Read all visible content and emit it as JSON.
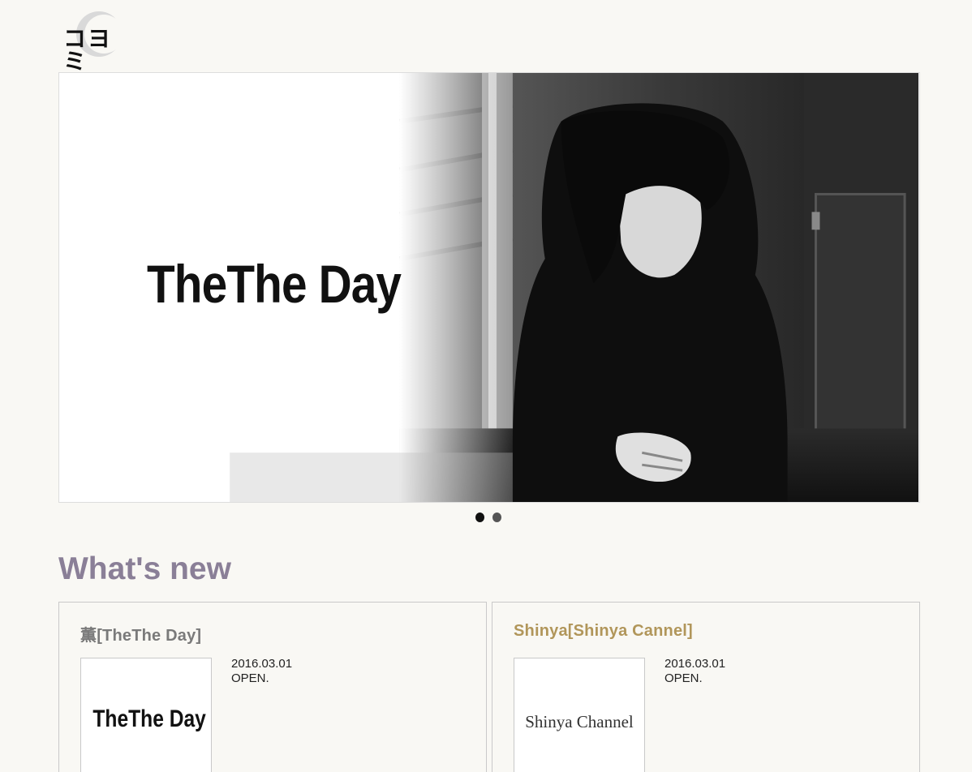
{
  "logo": {
    "text": "コヨミ"
  },
  "hero": {
    "title": "TheThe Day"
  },
  "slider": {
    "dots": 2,
    "active": 0
  },
  "section": {
    "title": "What's new"
  },
  "cards": [
    {
      "title": "薫[TheThe Day]",
      "thumb_text": "TheThe Day",
      "date": "2016.03.01",
      "status": "OPEN."
    },
    {
      "title": "Shinya[Shinya Cannel]",
      "thumb_text": "Shinya Channel",
      "date": "2016.03.01",
      "status": "OPEN."
    }
  ],
  "colors": {
    "background": "#f9f8f4",
    "heading": "#8a7f97",
    "card1_title": "#7a7a7a",
    "card2_title": "#b1965a"
  }
}
